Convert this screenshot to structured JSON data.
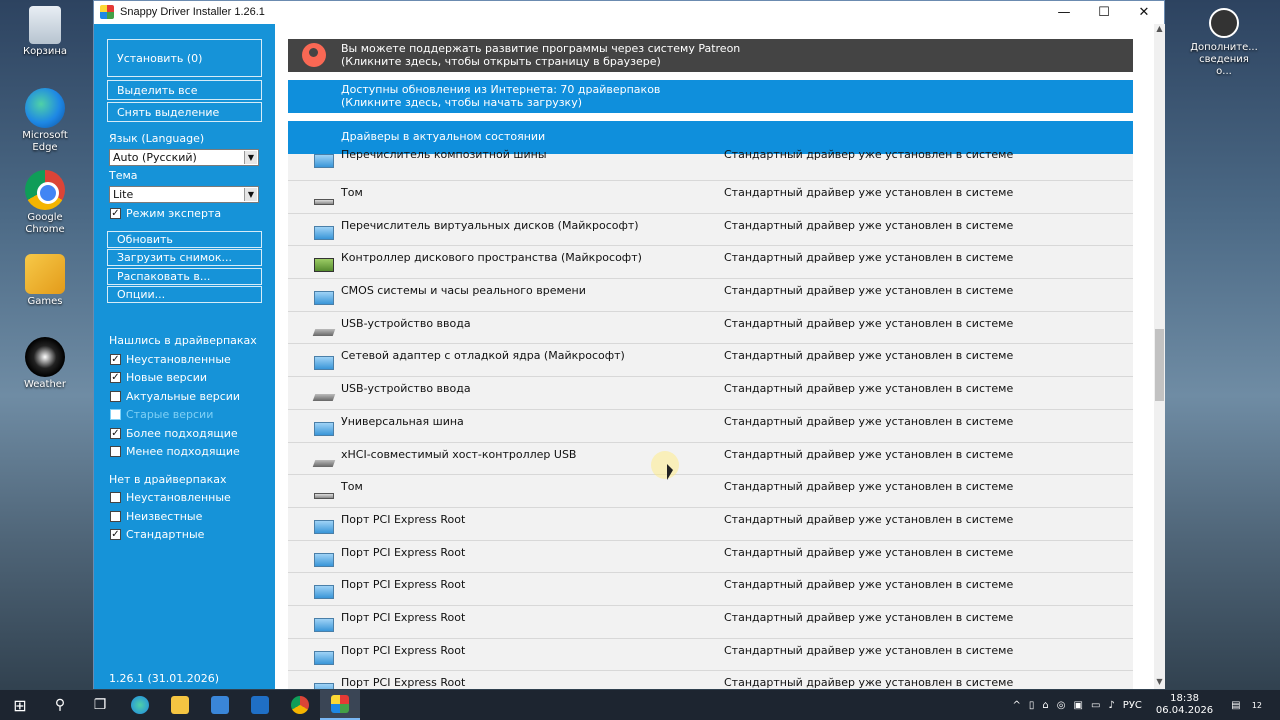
{
  "desktop": {
    "icons": [
      {
        "label": "Корзина"
      },
      {
        "label": "Microsoft Edge"
      },
      {
        "label": "Google Chrome"
      },
      {
        "label": "Games"
      },
      {
        "label": "Weather"
      }
    ],
    "right_icon": {
      "label": "Дополните... сведения о..."
    }
  },
  "window": {
    "title": "Snappy Driver Installer 1.26.1",
    "minimize": "—",
    "maximize": "☐",
    "close": "✕"
  },
  "sidebar": {
    "install_label": "Установить (0)",
    "select_all_label": "Выделить все",
    "deselect_label": "Снять выделение",
    "language_label": "Язык (Language)",
    "language_value": "Auto (Русский)",
    "theme_label": "Тема",
    "theme_value": "Lite",
    "expert_mode_label": "Режим эксперта",
    "expert_mode_checked": true,
    "refresh_label": "Обновить",
    "load_snapshot_label": "Загрузить снимок...",
    "extract_label": "Распаковать в...",
    "options_label": "Опции...",
    "found_header": "Нашлись в драйверпаках",
    "found_filters": [
      {
        "label": "Неустановленные",
        "checked": true
      },
      {
        "label": "Новые версии",
        "checked": true
      },
      {
        "label": "Актуальные версии",
        "checked": false
      },
      {
        "label": "Старые версии",
        "checked": false
      },
      {
        "label": "Более подходящие",
        "checked": true
      },
      {
        "label": "Менее подходящие",
        "checked": false
      }
    ],
    "notfound_header": "Нет в драйверпаках",
    "notfound_filters": [
      {
        "label": "Неустановленные",
        "checked": false
      },
      {
        "label": "Неизвестные",
        "checked": false
      },
      {
        "label": "Стандартные",
        "checked": true
      }
    ],
    "version": "1.26.1 (31.01.2026)"
  },
  "banners": {
    "patreon_line1": "Вы можете поддержать развитие программы через систему Patreon",
    "patreon_line2": "(Кликните здесь, чтобы открыть страницу в браузере)",
    "updates_line1": "Доступны обновления из Интернета: 70 драйверпаков",
    "updates_line2": "(Кликните здесь, чтобы начать загрузку)",
    "uptodate": "Драйверы в актуальном состоянии"
  },
  "devices": [
    {
      "name": "Перечислитель композитной шины",
      "status": "Стандартный драйвер уже установлен в системе",
      "icon": "pc-icon"
    },
    {
      "name": "Том",
      "status": "Стандартный драйвер уже установлен в системе",
      "icon": "drive-icon"
    },
    {
      "name": "Перечислитель виртуальных дисков (Майкрософт)",
      "status": "Стандартный драйвер уже установлен в системе",
      "icon": "pc-icon"
    },
    {
      "name": "Контроллер дискового пространства (Майкрософт)",
      "status": "Стандартный драйвер уже установлен в системе",
      "icon": "controller-icon"
    },
    {
      "name": "CMOS системы и часы реального времени",
      "status": "Стандартный драйвер уже установлен в системе",
      "icon": "pc-icon"
    },
    {
      "name": "USB-устройство ввода",
      "status": "Стандартный драйвер уже установлен в системе",
      "icon": "usb-icon"
    },
    {
      "name": "Сетевой адаптер с отладкой ядра (Майкрософт)",
      "status": "Стандартный драйвер уже установлен в системе",
      "icon": "pc-icon"
    },
    {
      "name": "USB-устройство ввода",
      "status": "Стандартный драйвер уже установлен в системе",
      "icon": "usb-icon"
    },
    {
      "name": "Универсальная шина",
      "status": "Стандартный драйвер уже установлен в системе",
      "icon": "pc-icon"
    },
    {
      "name": "xHCI-совместимый хост-контроллер USB",
      "status": "Стандартный драйвер уже установлен в системе",
      "icon": "usb-icon"
    },
    {
      "name": "Том",
      "status": "Стандартный драйвер уже установлен в системе",
      "icon": "drive-icon"
    },
    {
      "name": "Порт PCI Express Root",
      "status": "Стандартный драйвер уже установлен в системе",
      "icon": "pc-icon"
    },
    {
      "name": "Порт PCI Express Root",
      "status": "Стандартный драйвер уже установлен в системе",
      "icon": "pc-icon"
    },
    {
      "name": "Порт PCI Express Root",
      "status": "Стандартный драйвер уже установлен в системе",
      "icon": "pc-icon"
    },
    {
      "name": "Порт PCI Express Root",
      "status": "Стандартный драйвер уже установлен в системе",
      "icon": "pc-icon"
    },
    {
      "name": "Порт PCI Express Root",
      "status": "Стандартный драйвер уже установлен в системе",
      "icon": "pc-icon"
    },
    {
      "name": "Порт PCI Express Root",
      "status": "Стандартный драйвер уже установлен в системе",
      "icon": "pc-icon"
    }
  ],
  "taskbar": {
    "language": "РУС",
    "time": "18:38",
    "date": "06.04.2026",
    "notifications": "12"
  },
  "colors": {
    "sidebar": "#1693d8",
    "banner_blue": "#0f8fdc",
    "banner_dark": "#444444"
  }
}
